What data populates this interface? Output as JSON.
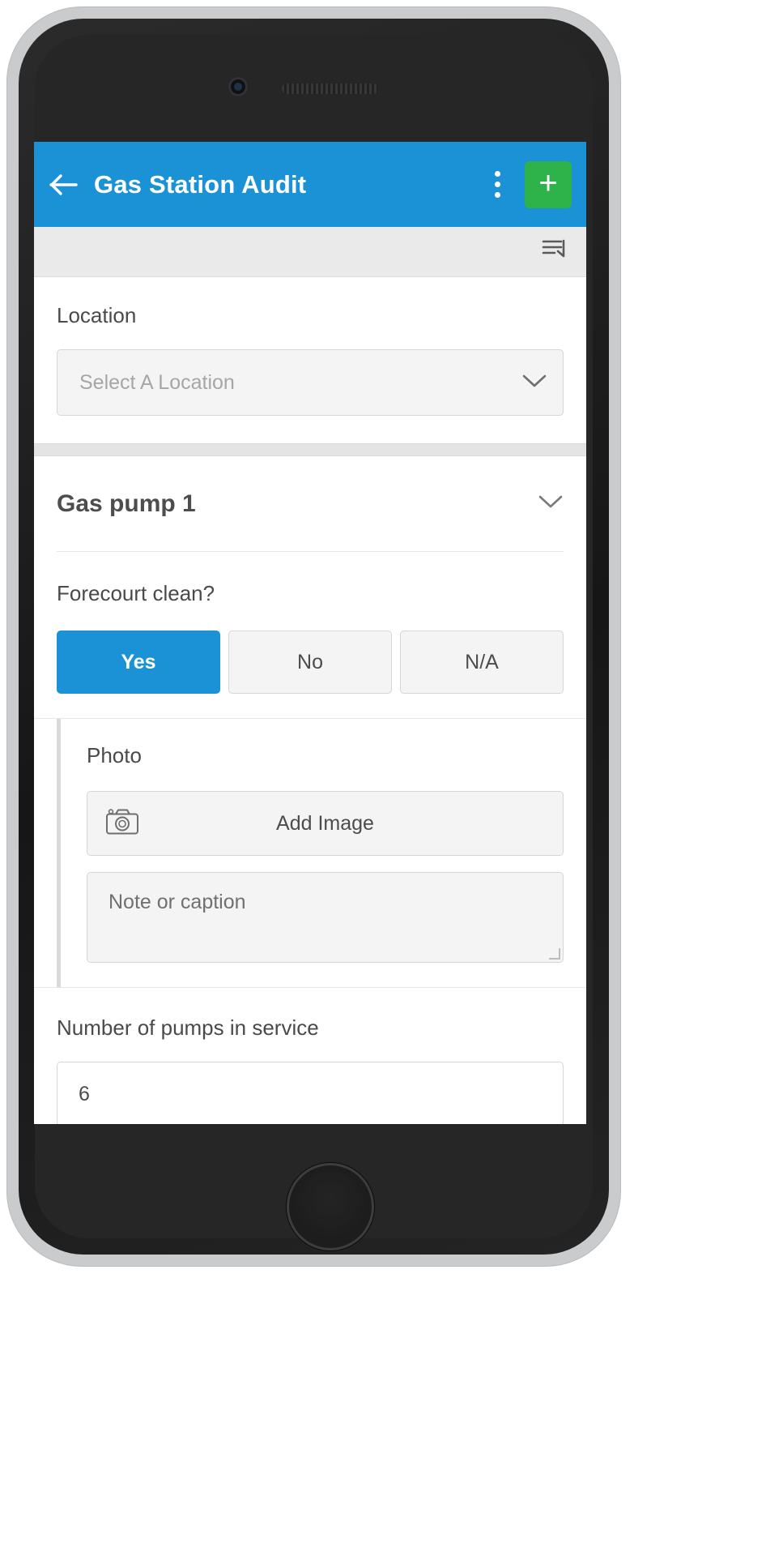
{
  "appbar": {
    "title": "Gas Station Audit",
    "back_icon": "arrow-left-icon",
    "menu_icon": "more-vertical-icon",
    "add_label": "+",
    "bg_color": "#1b92d6",
    "add_color": "#2eb34a"
  },
  "toolbar": {
    "sort_icon": "list-reorder-icon"
  },
  "location": {
    "label": "Location",
    "placeholder": "Select A Location",
    "chevron_icon": "chevron-down-icon"
  },
  "section": {
    "title": "Gas pump 1",
    "collapse_icon": "chevron-down-icon"
  },
  "question": {
    "text": "Forecourt clean?",
    "options": [
      {
        "label": "Yes",
        "selected": true
      },
      {
        "label": "No",
        "selected": false
      },
      {
        "label": "N/A",
        "selected": false
      }
    ]
  },
  "photo": {
    "label": "Photo",
    "add_image_label": "Add Image",
    "camera_icon": "camera-icon",
    "note_placeholder": "Note or caption"
  },
  "pumps": {
    "label": "Number of pumps in service",
    "value": "6"
  }
}
